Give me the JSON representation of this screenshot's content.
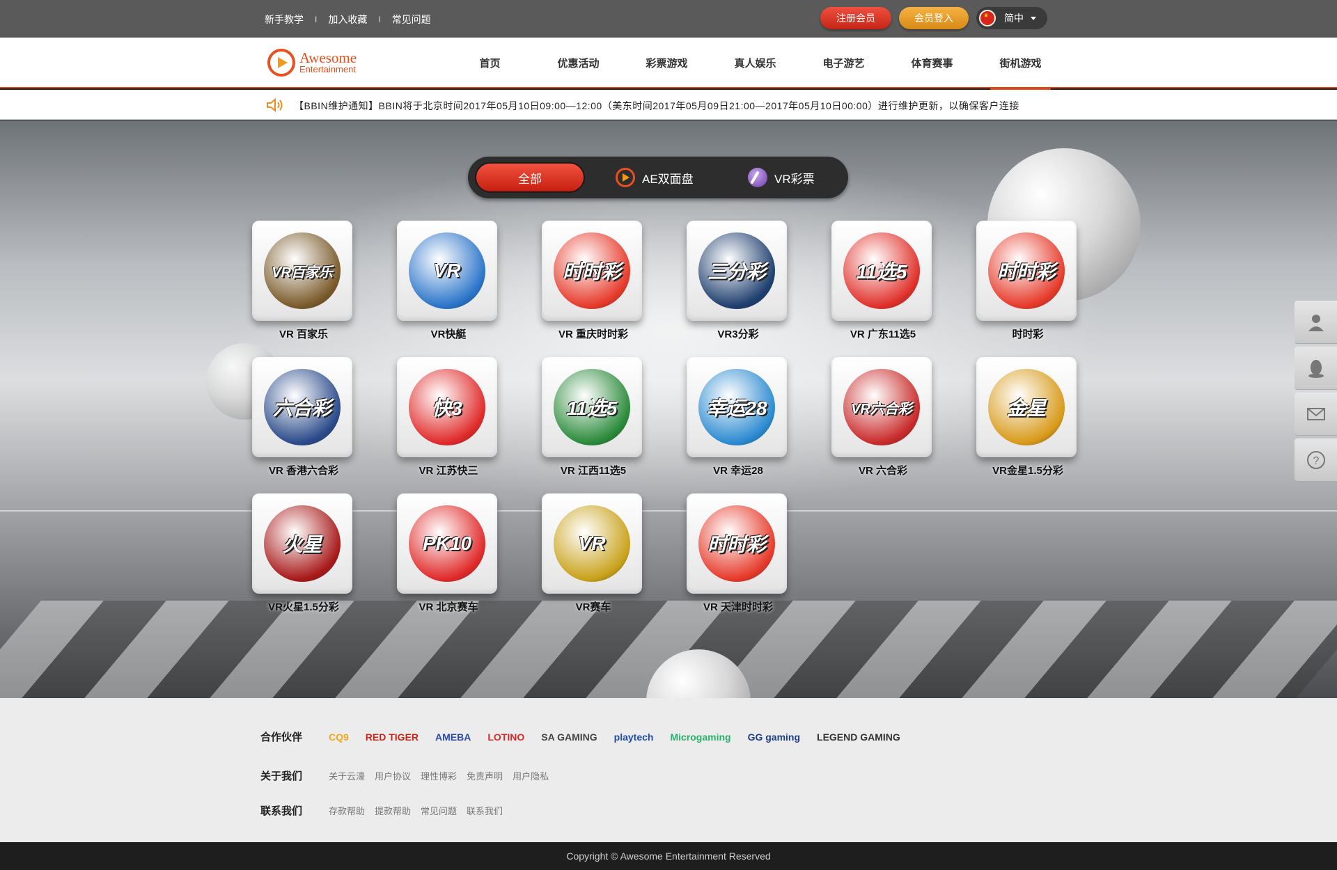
{
  "topbar": {
    "links": [
      "新手教学",
      "加入收藏",
      "常见问题"
    ],
    "separator": "I",
    "register_label": "注册会员",
    "login_label": "会员登入",
    "language": "简中"
  },
  "header": {
    "logo_line1": "Awesome",
    "logo_line2": "Entertainment",
    "nav": [
      "首页",
      "优惠活动",
      "彩票游戏",
      "真人娱乐",
      "电子游艺",
      "体育赛事",
      "街机游戏"
    ],
    "active_nav": "街机游戏"
  },
  "notice": {
    "text": "【BBIN维护通知】BBIN将于北京时间2017年05月10日09:00—12:00（美东时间2017年05月09日21:00—2017年05月10日00:00）进行维护更新，以确保客户连接"
  },
  "filter": {
    "all": "全部",
    "ae": "AE双面盘",
    "vr": "VR彩票"
  },
  "games": [
    {
      "label": "VR 百家乐",
      "art": "VR百家乐",
      "color": "#7a5a2a"
    },
    {
      "label": "VR快艇",
      "art": "VR",
      "color": "#2a74c9"
    },
    {
      "label": "VR 重庆时时彩",
      "art": "时时彩",
      "color": "#e63a2a"
    },
    {
      "label": "VR3分彩",
      "art": "三分彩",
      "color": "#1f3f6e"
    },
    {
      "label": "VR 广东11选5",
      "art": "11选5",
      "color": "#e0302a"
    },
    {
      "label": "时时彩",
      "art": "时时彩",
      "color": "#e63a2a"
    },
    {
      "label": "VR 香港六合彩",
      "art": "六合彩",
      "color": "#2a4a8a"
    },
    {
      "label": "VR 江苏快三",
      "art": "快3",
      "color": "#e02a2a"
    },
    {
      "label": "VR 江西11选5",
      "art": "11选5",
      "color": "#2a8a3a"
    },
    {
      "label": "VR 幸运28",
      "art": "幸运28",
      "color": "#2a8ad0"
    },
    {
      "label": "VR 六合彩",
      "art": "VR六合彩",
      "color": "#c92a2a"
    },
    {
      "label": "VR金星1.5分彩",
      "art": "金星",
      "color": "#d89a1a"
    },
    {
      "label": "VR火星1.5分彩",
      "art": "火星",
      "color": "#a81a1a"
    },
    {
      "label": "VR 北京赛车",
      "art": "PK10",
      "color": "#e02a2a"
    },
    {
      "label": "VR赛车",
      "art": "VR",
      "color": "#c9a21a"
    },
    {
      "label": "VR 天津时时彩",
      "art": "时时彩",
      "color": "#e63a2a"
    }
  ],
  "footer": {
    "partners_title": "合作伙伴",
    "partners": [
      {
        "name": "CQ9",
        "color": "#f0a81a"
      },
      {
        "name": "RED TIGER",
        "color": "#c9261a"
      },
      {
        "name": "AMEBA",
        "color": "#2a4aa8"
      },
      {
        "name": "LOTINO",
        "color": "#d82a2a"
      },
      {
        "name": "SA GAMING",
        "color": "#444444"
      },
      {
        "name": "playtech",
        "color": "#1f4aa8"
      },
      {
        "name": "Microgaming",
        "color": "#2ab06a"
      },
      {
        "name": "GG gaming",
        "color": "#1f3f8a"
      },
      {
        "name": "LEGEND GAMING",
        "color": "#333333"
      }
    ],
    "about_title": "关于我们",
    "about_links": [
      "关于云濠",
      "用户协议",
      "理性博彩",
      "免责声明",
      "用户隐私"
    ],
    "contact_title": "联系我们",
    "contact_links": [
      "存款帮助",
      "提款帮助",
      "常见问题",
      "联系我们"
    ],
    "copyright": "Copyright © Awesome Entertainment Reserved"
  }
}
